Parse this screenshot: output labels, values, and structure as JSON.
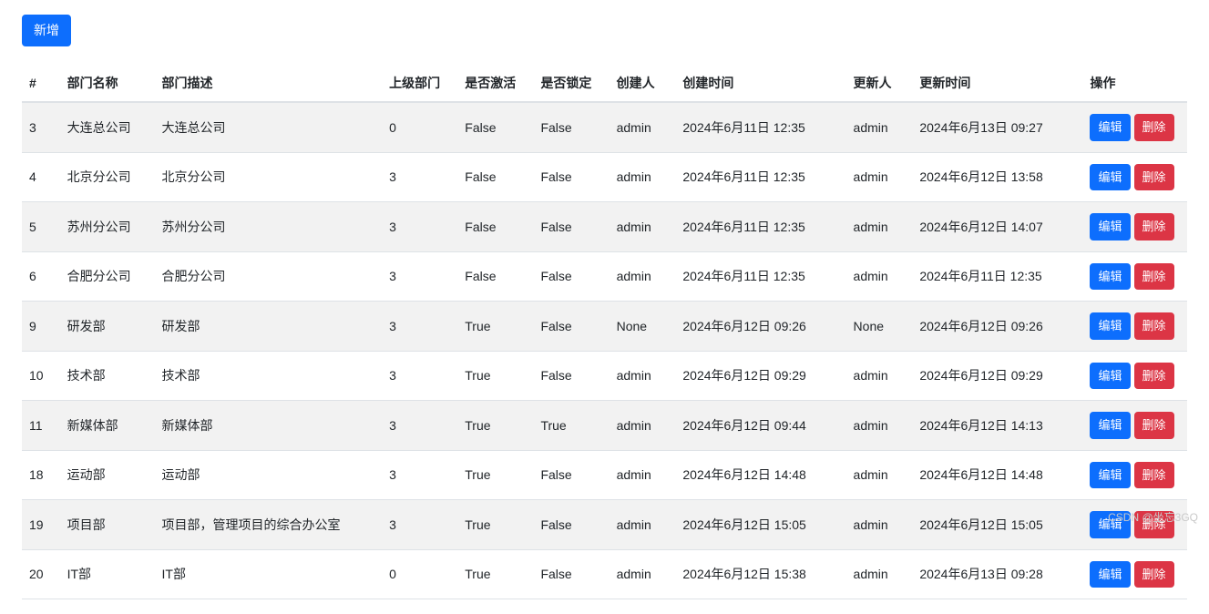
{
  "toolbar": {
    "add_label": "新增"
  },
  "table": {
    "headers": {
      "num": "#",
      "name": "部门名称",
      "desc": "部门描述",
      "parent": "上级部门",
      "active": "是否激活",
      "locked": "是否锁定",
      "creator": "创建人",
      "ctime": "创建时间",
      "updater": "更新人",
      "utime": "更新时间",
      "action": "操作"
    },
    "action_labels": {
      "edit": "编辑",
      "delete": "删除"
    },
    "rows": [
      {
        "num": "3",
        "name": "大连总公司",
        "desc": "大连总公司",
        "parent": "0",
        "active": "False",
        "locked": "False",
        "creator": "admin",
        "ctime": "2024年6月11日 12:35",
        "updater": "admin",
        "utime": "2024年6月13日 09:27"
      },
      {
        "num": "4",
        "name": "北京分公司",
        "desc": "北京分公司",
        "parent": "3",
        "active": "False",
        "locked": "False",
        "creator": "admin",
        "ctime": "2024年6月11日 12:35",
        "updater": "admin",
        "utime": "2024年6月12日 13:58"
      },
      {
        "num": "5",
        "name": "苏州分公司",
        "desc": "苏州分公司",
        "parent": "3",
        "active": "False",
        "locked": "False",
        "creator": "admin",
        "ctime": "2024年6月11日 12:35",
        "updater": "admin",
        "utime": "2024年6月12日 14:07"
      },
      {
        "num": "6",
        "name": "合肥分公司",
        "desc": "合肥分公司",
        "parent": "3",
        "active": "False",
        "locked": "False",
        "creator": "admin",
        "ctime": "2024年6月11日 12:35",
        "updater": "admin",
        "utime": "2024年6月11日 12:35"
      },
      {
        "num": "9",
        "name": "研发部",
        "desc": "研发部",
        "parent": "3",
        "active": "True",
        "locked": "False",
        "creator": "None",
        "ctime": "2024年6月12日 09:26",
        "updater": "None",
        "utime": "2024年6月12日 09:26"
      },
      {
        "num": "10",
        "name": "技术部",
        "desc": "技术部",
        "parent": "3",
        "active": "True",
        "locked": "False",
        "creator": "admin",
        "ctime": "2024年6月12日 09:29",
        "updater": "admin",
        "utime": "2024年6月12日 09:29"
      },
      {
        "num": "11",
        "name": "新媒体部",
        "desc": "新媒体部",
        "parent": "3",
        "active": "True",
        "locked": "True",
        "creator": "admin",
        "ctime": "2024年6月12日 09:44",
        "updater": "admin",
        "utime": "2024年6月12日 14:13"
      },
      {
        "num": "18",
        "name": "运动部",
        "desc": "运动部",
        "parent": "3",
        "active": "True",
        "locked": "False",
        "creator": "admin",
        "ctime": "2024年6月12日 14:48",
        "updater": "admin",
        "utime": "2024年6月12日 14:48"
      },
      {
        "num": "19",
        "name": "项目部",
        "desc": "项目部，管理项目的综合办公室",
        "parent": "3",
        "active": "True",
        "locked": "False",
        "creator": "admin",
        "ctime": "2024年6月12日 15:05",
        "updater": "admin",
        "utime": "2024年6月12日 15:05"
      },
      {
        "num": "20",
        "name": "IT部",
        "desc": "IT部",
        "parent": "0",
        "active": "True",
        "locked": "False",
        "creator": "admin",
        "ctime": "2024年6月12日 15:38",
        "updater": "admin",
        "utime": "2024年6月13日 09:28"
      }
    ]
  },
  "watermark": "CSDN @坐忘3GQ"
}
